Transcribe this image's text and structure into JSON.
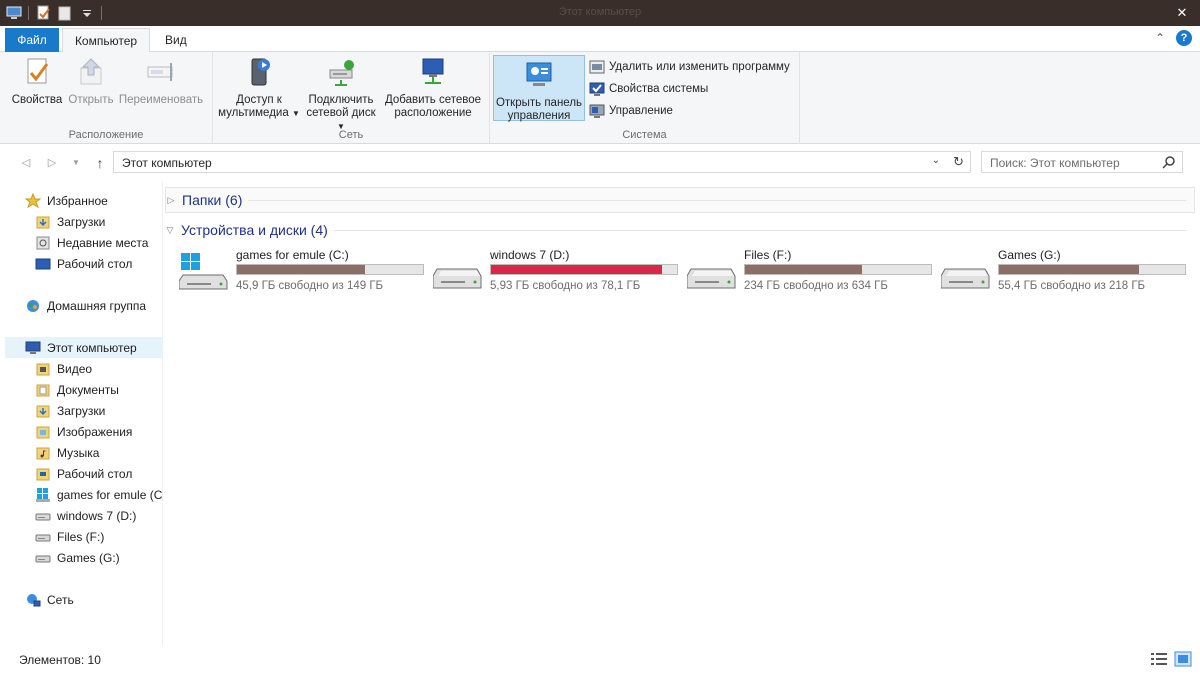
{
  "window": {
    "title": "Этот компьютер",
    "accent": "#1979ca",
    "titlebar_color": "#3a2e2a"
  },
  "quick_access": [
    "computer-icon",
    "properties-icon",
    "new-folder-icon",
    "customize-dropdown-icon"
  ],
  "ribbon_tabs": {
    "file": "Файл",
    "computer": "Компьютер",
    "view": "Вид"
  },
  "ribbon": {
    "location": {
      "label": "Расположение",
      "properties": "Свойства",
      "open": "Открыть",
      "rename": "Переименовать"
    },
    "network": {
      "label": "Сеть",
      "media_line1": "Доступ к",
      "media_line2": "мультимедиа",
      "map_line1": "Подключить",
      "map_line2": "сетевой диск",
      "add_line1": "Добавить сетевое",
      "add_line2": "расположение"
    },
    "system": {
      "label": "Система",
      "control_panel_line1": "Открыть панель",
      "control_panel_line2": "управления",
      "uninstall": "Удалить или изменить программу",
      "system_properties": "Свойства системы",
      "manage": "Управление"
    }
  },
  "address_bar": {
    "path": "Этот компьютер",
    "search_placeholder": "Поиск: Этот компьютер"
  },
  "nav_pane": {
    "favorites": "Избранное",
    "downloads": "Загрузки",
    "recent": "Недавние места",
    "desktop": "Рабочий стол",
    "homegroup": "Домашняя группа",
    "this_pc": "Этот компьютер",
    "video": "Видео",
    "documents": "Документы",
    "downloads2": "Загрузки",
    "pictures": "Изображения",
    "music": "Музыка",
    "desktop2": "Рабочий стол",
    "drive_c": "games for emule (C:",
    "drive_d": "windows 7 (D:)",
    "drive_f": "Files (F:)",
    "drive_g": "Games (G:)",
    "network": "Сеть"
  },
  "content": {
    "folders_header": "Папки (6)",
    "devices_header": "Устройства и диски (4)",
    "drives": [
      {
        "name": "games for emule (C:)",
        "free_text": "45,9 ГБ свободно из 149 ГБ",
        "used_fraction": 0.69,
        "critical": false
      },
      {
        "name": "windows 7 (D:)",
        "free_text": "5,93 ГБ свободно из 78,1 ГБ",
        "used_fraction": 0.92,
        "critical": true
      },
      {
        "name": "Files (F:)",
        "free_text": "234 ГБ свободно из 634 ГБ",
        "used_fraction": 0.63,
        "critical": false
      },
      {
        "name": "Games (G:)",
        "free_text": "55,4 ГБ свободно из 218 ГБ",
        "used_fraction": 0.75,
        "critical": false
      }
    ]
  },
  "status": {
    "items": "Элементов: 10"
  }
}
